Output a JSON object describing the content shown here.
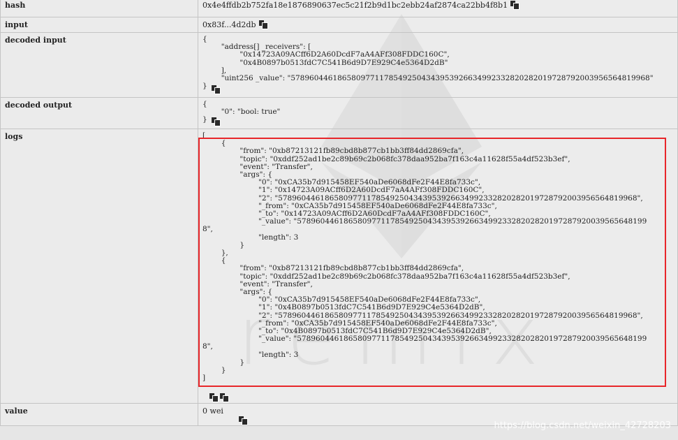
{
  "rows": {
    "hash": {
      "label": "hash",
      "value": "0x4e4ffdb2b752fa18e1876890637ec5c21f2b9d1bc2ebb24af2874ca22bb4f8b1"
    },
    "input": {
      "label": "input",
      "value": "0x83f...4d2db"
    },
    "decoded_input": {
      "label": "decoded input",
      "text": "{\n        \"address[] _receivers\": [\n                \"0x14723A09ACff6D2A60DcdF7aA4AFf308FDDC160C\",\n                \"0x4B0897b0513fdC7C541B6d9D7E929C4e5364D2dB\"\n        ],\n        \"uint256 _value\": \"57896044618658097711785492504343953926634992332820282019728792003956564819968\"\n}"
    },
    "decoded_output": {
      "label": "decoded output",
      "text": "{\n        \"0\": \"bool: true\"\n}"
    },
    "logs": {
      "label": "logs",
      "text": "[\n        {\n                \"from\": \"0xb87213121fb89cbd8b877cb1bb3ff84dd2869cfa\",\n                \"topic\": \"0xddf252ad1be2c89b69c2b068fc378daa952ba7f163c4a11628f55a4df523b3ef\",\n                \"event\": \"Transfer\",\n                \"args\": {\n                        \"0\": \"0xCA35b7d915458EF540aDe6068dFe2F44E8fa733c\",\n                        \"1\": \"0x14723A09ACff6D2A60DcdF7aA4AFf308FDDC160C\",\n                        \"2\": \"57896044618658097711785492504343953926634992332820282019728792003956564819968\",\n                        \"_from\": \"0xCA35b7d915458EF540aDe6068dFe2F44E8fa733c\",\n                        \"_to\": \"0x14723A09ACff6D2A60DcdF7aA4AFf308FDDC160C\",\n                        \"_value\": \"578960446186580977117854925043439539266349923328202820197287920039565648199\n8\",\n                        \"length\": 3\n                }\n        },\n        {\n                \"from\": \"0xb87213121fb89cbd8b877cb1bb3ff84dd2869cfa\",\n                \"topic\": \"0xddf252ad1be2c89b69c2b068fc378daa952ba7f163c4a11628f55a4df523b3ef\",\n                \"event\": \"Transfer\",\n                \"args\": {\n                        \"0\": \"0xCA35b7d915458EF540aDe6068dFe2F44E8fa733c\",\n                        \"1\": \"0x4B0897b0513fdC7C541B6d9D7E929C4e5364D2dB\",\n                        \"2\": \"57896044618658097711785492504343953926634992332820282019728792003956564819968\",\n                        \"_from\": \"0xCA35b7d915458EF540aDe6068dFe2F44E8fa733c\",\n                        \"_to\": \"0x4B0897b0513fdC7C541B6d9D7E929C4e5364D2dB\",\n                        \"_value\": \"578960446186580977117854925043439539266349923328202820197287920039565648199\n8\",\n                        \"length\": 3\n                }\n        }\n]"
    },
    "value": {
      "label": "value",
      "value": "0 wei"
    }
  },
  "icons": {
    "copy": "copy-icon",
    "watermark_logo": "ethereum-logo",
    "watermark_text": "remix"
  },
  "colors": {
    "highlight": "#e8262a"
  },
  "watermark": {
    "brand": "remix",
    "footer": "https://blog.csdn.net/weixin_42728203"
  }
}
